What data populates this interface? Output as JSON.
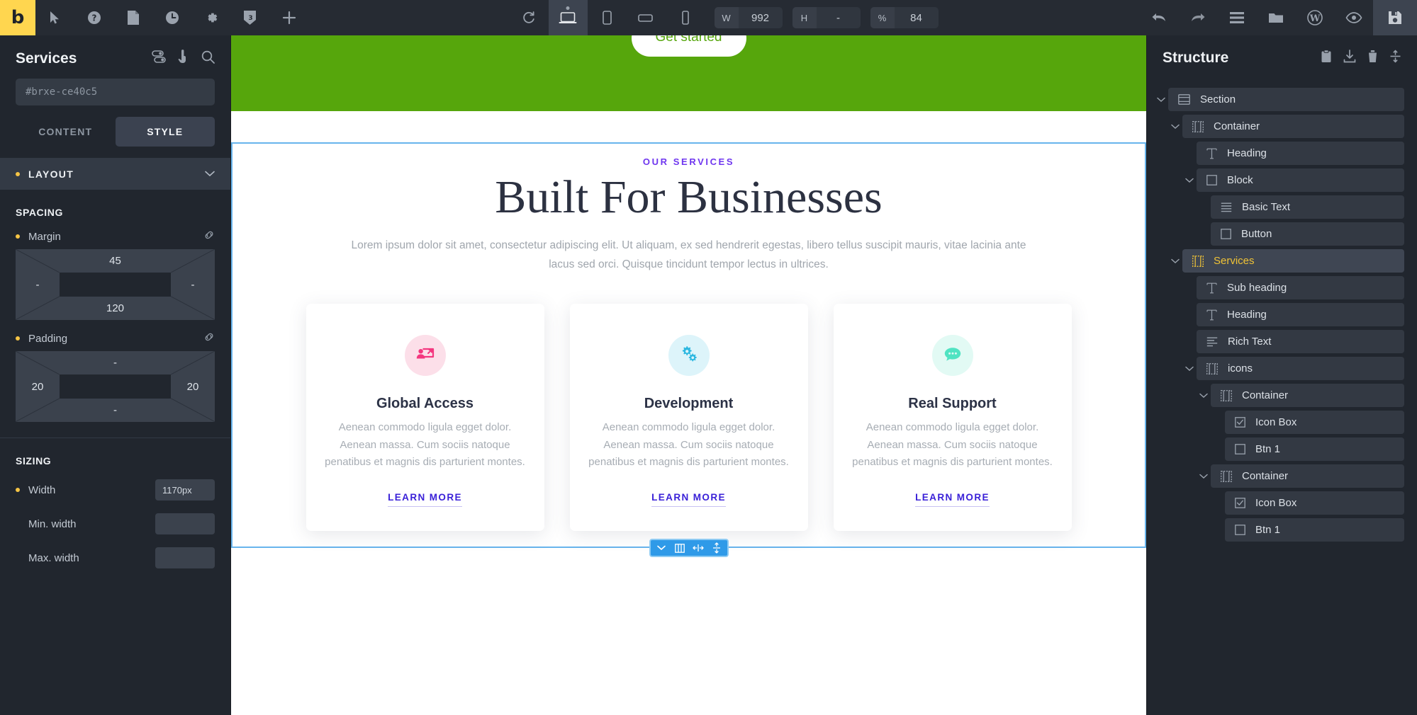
{
  "topbar": {
    "logo": "b",
    "left_icons": [
      "cursor-icon",
      "help-icon",
      "page-icon",
      "history-icon",
      "settings-icon",
      "css-icon",
      "add-icon"
    ],
    "center_icons": [
      "reload-icon",
      "desktop-icon",
      "tablet-portrait-icon",
      "tablet-landscape-icon",
      "mobile-icon"
    ],
    "right_icons": [
      "undo-icon",
      "redo-icon",
      "menu-icon",
      "folder-icon",
      "wordpress-icon",
      "preview-icon",
      "save-icon"
    ],
    "dims": [
      {
        "label": "W",
        "value": "992"
      },
      {
        "label": "H",
        "value": "-"
      },
      {
        "label": "%",
        "value": "84"
      }
    ]
  },
  "left_panel": {
    "title": "Services",
    "head_icons": [
      "toggles-icon",
      "interactions-icon",
      "search-icon"
    ],
    "element_id": "#brxe-ce40c5",
    "tabs": [
      {
        "label": "CONTENT",
        "active": false
      },
      {
        "label": "STYLE",
        "active": true
      }
    ],
    "section": {
      "title": "LAYOUT",
      "expanded": true
    },
    "spacing": {
      "heading": "SPACING",
      "margin": {
        "label": "Margin",
        "top": "45",
        "right": "-",
        "bottom": "120",
        "left": "-"
      },
      "padding": {
        "label": "Padding",
        "top": "-",
        "right": "20",
        "bottom": "-",
        "left": "20"
      }
    },
    "sizing": {
      "heading": "SIZING",
      "fields": [
        {
          "label": "Width",
          "value": "1170px",
          "modified": true
        },
        {
          "label": "Min. width",
          "value": "",
          "modified": false
        },
        {
          "label": "Max. width",
          "value": "",
          "modified": false
        }
      ]
    }
  },
  "canvas": {
    "hero": {
      "button_label": "Get started",
      "band_color": "#56a60c"
    },
    "services": {
      "sub_heading": "OUR SERVICES",
      "sub_heading_color": "#6f36ef",
      "heading": "Built For Businesses",
      "rich_text_line1": "Lorem ipsum dolor sit amet, consectetur adipiscing elit. Ut aliquam, ex sed hendrerit egestas, libero tellus suscipit mauris,",
      "rich_text_line2": "vitae lacinia ante lacus sed orci. Quisque tincidunt tempor lectus in ultrices.",
      "cards": [
        {
          "icon": "presentation-user-icon",
          "icon_color": "#f4377f",
          "icon_bg": "#fcdfe9",
          "title": "Global Access",
          "text": "Aenean commodo ligula egget dolor. Aenean massa. Cum sociis natoque penatibus et magnis dis parturient montes.",
          "link": "LEARN MORE"
        },
        {
          "icon": "gears-icon",
          "icon_color": "#2bb7e0",
          "icon_bg": "#ddf4fa",
          "title": "Development",
          "text": "Aenean commodo ligula egget dolor. Aenean massa. Cum sociis natoque penatibus et magnis dis parturient montes.",
          "link": "LEARN MORE"
        },
        {
          "icon": "chat-bubble-icon",
          "icon_color": "#50e3c2",
          "icon_bg": "#e2faf4",
          "title": "Real Support",
          "text": "Aenean commodo ligula egget dolor. Aenean massa. Cum sociis natoque penatibus et magnis dis parturient montes.",
          "link": "LEARN MORE"
        }
      ]
    },
    "float_toolbar": {
      "accent": "#2f9ae8",
      "buttons": [
        "chevron-down-icon",
        "columns-icon",
        "horizontal-resize-icon",
        "vertical-resize-icon"
      ]
    }
  },
  "right_panel": {
    "title": "Structure",
    "icons": [
      "clipboard-icon",
      "import-icon",
      "trash-icon",
      "collapse-icon"
    ],
    "tree": [
      {
        "label": "Section",
        "icon": "section-icon",
        "depth": 0,
        "chevron": true,
        "selected": false
      },
      {
        "label": "Container",
        "icon": "container-icon",
        "depth": 1,
        "chevron": true,
        "selected": false
      },
      {
        "label": "Heading",
        "icon": "text-icon",
        "depth": 2,
        "chevron": false,
        "selected": false
      },
      {
        "label": "Block",
        "icon": "block-icon",
        "depth": 2,
        "chevron": true,
        "selected": false
      },
      {
        "label": "Basic Text",
        "icon": "lines-icon",
        "depth": 3,
        "chevron": false,
        "selected": false
      },
      {
        "label": "Button",
        "icon": "block-icon",
        "depth": 3,
        "chevron": false,
        "selected": false
      },
      {
        "label": "Services",
        "icon": "container-icon",
        "depth": 1,
        "chevron": true,
        "selected": true
      },
      {
        "label": "Sub heading",
        "icon": "text-icon",
        "depth": 2,
        "chevron": false,
        "selected": false
      },
      {
        "label": "Heading",
        "icon": "text-icon",
        "depth": 2,
        "chevron": false,
        "selected": false
      },
      {
        "label": "Rich Text",
        "icon": "richtext-icon",
        "depth": 2,
        "chevron": false,
        "selected": false
      },
      {
        "label": "icons",
        "icon": "container-icon",
        "depth": 2,
        "chevron": true,
        "selected": false
      },
      {
        "label": "Container",
        "icon": "container-icon",
        "depth": 3,
        "chevron": true,
        "selected": false
      },
      {
        "label": "Icon Box",
        "icon": "checkbox-icon",
        "depth": 4,
        "chevron": false,
        "selected": false
      },
      {
        "label": "Btn 1",
        "icon": "block-icon",
        "depth": 4,
        "chevron": false,
        "selected": false
      },
      {
        "label": "Container",
        "icon": "container-icon",
        "depth": 3,
        "chevron": true,
        "selected": false
      },
      {
        "label": "Icon Box",
        "icon": "checkbox-icon",
        "depth": 4,
        "chevron": false,
        "selected": false
      },
      {
        "label": "Btn 1",
        "icon": "block-icon",
        "depth": 4,
        "chevron": false,
        "selected": false
      }
    ]
  }
}
